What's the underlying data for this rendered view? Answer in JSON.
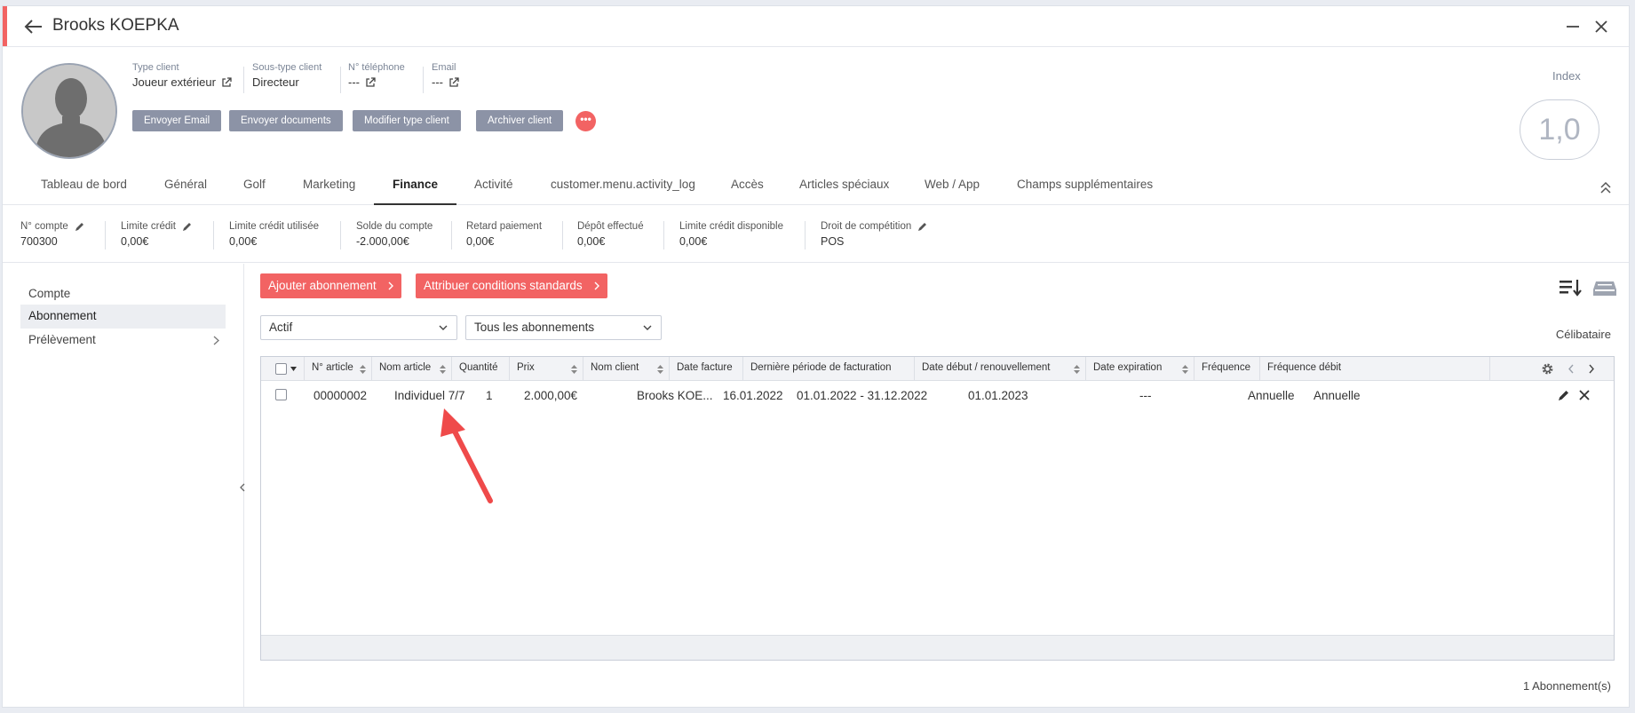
{
  "window": {
    "title": "Brooks KOEPKA"
  },
  "client_info": [
    {
      "label": "Type client",
      "value": "Joueur extérieur",
      "has_link": true
    },
    {
      "label": "Sous-type client",
      "value": "Directeur",
      "has_link": false
    },
    {
      "label": "N° téléphone",
      "value": "---",
      "has_link": true
    },
    {
      "label": "Email",
      "value": "---",
      "has_link": true
    }
  ],
  "actions": {
    "send_email": "Envoyer Email",
    "send_documents": "Envoyer documents",
    "modify_type": "Modifier type client",
    "archive": "Archiver client",
    "more": "•••"
  },
  "index": {
    "label": "Index",
    "value": "1,0"
  },
  "tabs": [
    "Tableau de bord",
    "Général",
    "Golf",
    "Marketing",
    "Finance",
    "Activité",
    "customer.menu.activity_log",
    "Accès",
    "Articles spéciaux",
    "Web / App",
    "Champs supplémentaires"
  ],
  "active_tab": "Finance",
  "finance_summary": [
    {
      "label": "N° compte",
      "value": "700300",
      "editable": true
    },
    {
      "label": "Limite crédit",
      "value": "0,00€",
      "editable": true
    },
    {
      "label": "Limite crédit utilisée",
      "value": "0,00€",
      "editable": false
    },
    {
      "label": "Solde du compte",
      "value": "-2.000,00€",
      "editable": false
    },
    {
      "label": "Retard paiement",
      "value": "0,00€",
      "editable": false
    },
    {
      "label": "Dépôt effectué",
      "value": "0,00€",
      "editable": false
    },
    {
      "label": "Limite crédit disponible",
      "value": "0,00€",
      "editable": false
    },
    {
      "label": "Droit de compétition",
      "value": "POS",
      "editable": true
    }
  ],
  "sidebar": [
    {
      "label": "Compte"
    },
    {
      "label": "Abonnement",
      "active": true
    },
    {
      "label": "Prélèvement",
      "has_children": true
    }
  ],
  "toolbar": {
    "add_subscription": "Ajouter abonnement",
    "assign_conditions": "Attribuer conditions standards"
  },
  "filters": {
    "status": "Actif",
    "type": "Tous les abonnements"
  },
  "family_status": "Célibataire",
  "table": {
    "columns": [
      "N° article",
      "Nom article",
      "Quantité",
      "Prix",
      "Nom client",
      "Date facture",
      "Dernière période de facturation",
      "Date début / renouvellement",
      "Date expiration",
      "Fréquence",
      "Fréquence débit"
    ],
    "rows": [
      {
        "article_no": "00000002",
        "article_name": "Individuel 7/7",
        "quantity": "1",
        "price": "2.000,00€",
        "client_name": "Brooks KOE...",
        "invoice_date": "16.01.2022",
        "last_billing_period": "01.01.2022 - 31.12.2022",
        "start_renewal": "01.01.2023",
        "expiration": "---",
        "frequency": "Annuelle",
        "debit_frequency": "Annuelle"
      }
    ]
  },
  "footer_count": "1 Abonnement(s)",
  "colors": {
    "accent": "#f26363",
    "button_grey": "#8c93a6",
    "annotation_arrow": "#ef4a4a"
  }
}
